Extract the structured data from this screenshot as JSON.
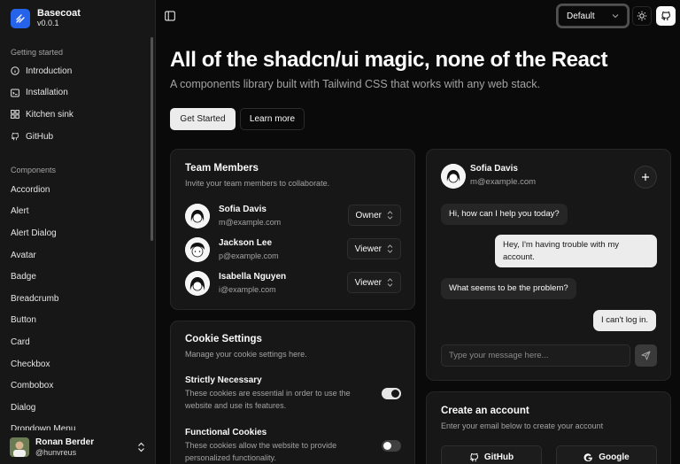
{
  "brand": {
    "name": "Basecoat",
    "version": "v0.0.1"
  },
  "sidebar": {
    "groups": [
      {
        "label": "Getting started",
        "items": [
          {
            "label": "Introduction",
            "icon": "circle-info-icon"
          },
          {
            "label": "Installation",
            "icon": "terminal-icon"
          },
          {
            "label": "Kitchen sink",
            "icon": "grid-icon"
          },
          {
            "label": "GitHub",
            "icon": "github-icon"
          }
        ]
      },
      {
        "label": "Components",
        "items": [
          {
            "label": "Accordion"
          },
          {
            "label": "Alert"
          },
          {
            "label": "Alert Dialog"
          },
          {
            "label": "Avatar"
          },
          {
            "label": "Badge"
          },
          {
            "label": "Breadcrumb"
          },
          {
            "label": "Button"
          },
          {
            "label": "Card"
          },
          {
            "label": "Checkbox"
          },
          {
            "label": "Combobox"
          },
          {
            "label": "Dialog"
          },
          {
            "label": "Dropdown Menu"
          }
        ]
      }
    ],
    "user": {
      "name": "Ronan Berder",
      "handle": "@hunvreus"
    }
  },
  "header": {
    "theme_select": "Default"
  },
  "hero": {
    "title": "All of the shadcn/ui magic, none of the React",
    "subtitle": "A components library built with Tailwind CSS that works with any web stack.",
    "primary_button": "Get Started",
    "secondary_button": "Learn more"
  },
  "team": {
    "title": "Team Members",
    "description": "Invite your team members to collaborate.",
    "members": [
      {
        "name": "Sofia Davis",
        "email": "m@example.com",
        "role": "Owner"
      },
      {
        "name": "Jackson Lee",
        "email": "p@example.com",
        "role": "Viewer"
      },
      {
        "name": "Isabella Nguyen",
        "email": "i@example.com",
        "role": "Viewer"
      }
    ]
  },
  "cookies": {
    "title": "Cookie Settings",
    "description": "Manage your cookie settings here.",
    "items": [
      {
        "title": "Strictly Necessary",
        "description": "These cookies are essential in order to use the website and use its features.",
        "enabled": true
      },
      {
        "title": "Functional Cookies",
        "description": "These cookies allow the website to provide personalized functionality.",
        "enabled": false
      }
    ]
  },
  "chat": {
    "name": "Sofia Davis",
    "email": "m@example.com",
    "messages": [
      {
        "from": "agent",
        "text": "Hi, how can I help you today?"
      },
      {
        "from": "user",
        "text": "Hey, I'm having trouble with my account."
      },
      {
        "from": "agent",
        "text": "What seems to be the problem?"
      },
      {
        "from": "user",
        "text": "I can't log in."
      }
    ],
    "input_placeholder": "Type your message here..."
  },
  "account": {
    "title": "Create an account",
    "description": "Enter your email below to create your account",
    "github_button": "GitHub",
    "google_button": "Google"
  },
  "colors": {
    "accent": "#2563eb",
    "background": "#0a0a0a",
    "card": "#171717"
  }
}
